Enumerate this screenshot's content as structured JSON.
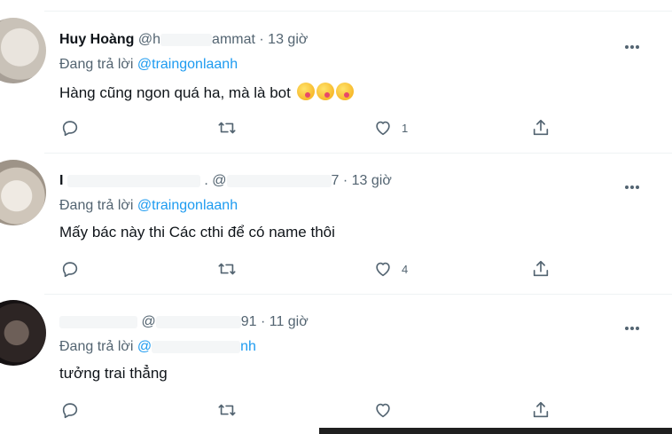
{
  "tweets": [
    {
      "name": "Huy Hoàng",
      "handle_visible_start": "@h",
      "handle_visible_end": "ammat",
      "time": "· 13 giờ",
      "reply_prefix": "Đang trả lời",
      "reply_mention": "@traingonlaanh",
      "text": "Hàng cũng ngon quá ha, mà là bot",
      "emoji_count": 3,
      "like_count": "1"
    },
    {
      "name": "I",
      "handle_visible_start": ". @",
      "handle_visible_end": "7",
      "time": "· 13 giờ",
      "reply_prefix": "Đang trả lời",
      "reply_mention": "@traingonlaanh",
      "text": "Mấy bác này thi Các cthi để có name thôi",
      "like_count": "4"
    },
    {
      "name": "",
      "handle_visible_start": "@",
      "handle_visible_end": "91",
      "time": "· 11 giờ",
      "reply_prefix": "Đang trả lời",
      "reply_mention_start": "@",
      "reply_mention_end": "nh",
      "text": "tưởng trai thẳng",
      "like_count": ""
    }
  ],
  "colors": {
    "text_primary": "#0f1419",
    "text_secondary": "#536471",
    "mention": "#1d9bf0",
    "divider": "#eff3f4"
  },
  "icons": [
    "reply-icon",
    "retweet-icon",
    "like-icon",
    "share-icon",
    "more-icon"
  ]
}
